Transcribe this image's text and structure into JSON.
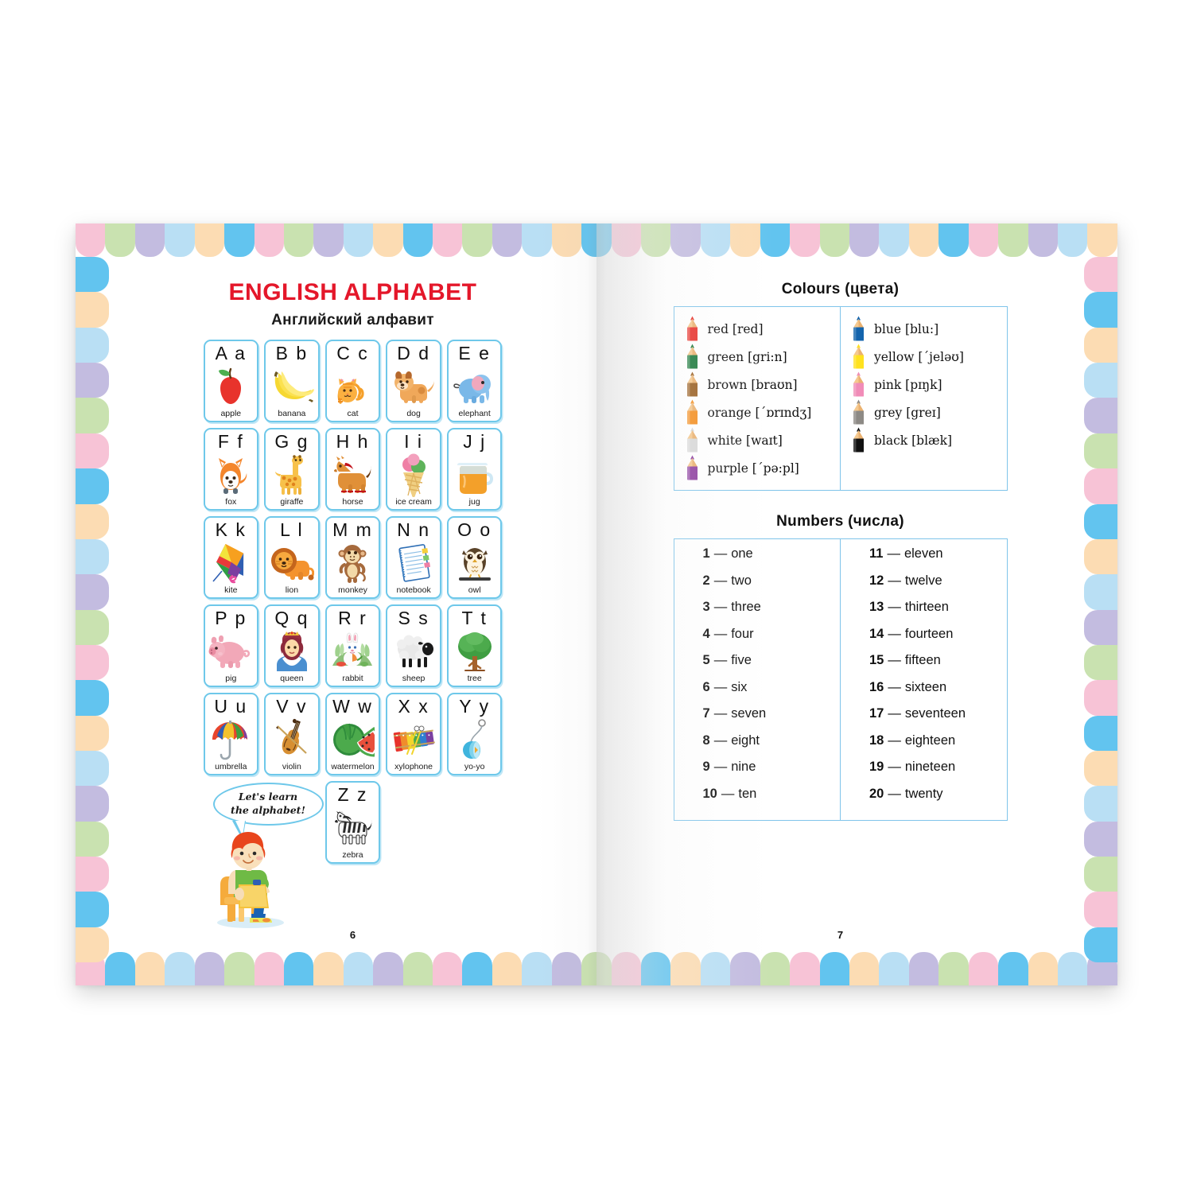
{
  "book": {
    "left_page_number": "6",
    "right_page_number": "7",
    "border_colors": [
      "#f7c3d6",
      "#c9e2b0",
      "#c3bce0",
      "#b9dff4",
      "#fcdcb3",
      "#62c4ef"
    ],
    "accent_blue": "#6ec8ea",
    "title_red": "#e4172a"
  },
  "left_page": {
    "title": "ENGLISH ALPHABET",
    "subtitle": "Английский  алфавит",
    "mascot": {
      "bubble_line1": "Let's learn",
      "bubble_line2": "the alphabet!"
    },
    "letters": [
      {
        "letter": "A a",
        "word": "apple",
        "icon": "apple-icon"
      },
      {
        "letter": "B b",
        "word": "banana",
        "icon": "banana-icon"
      },
      {
        "letter": "C c",
        "word": "cat",
        "icon": "cat-icon"
      },
      {
        "letter": "D d",
        "word": "dog",
        "icon": "dog-icon"
      },
      {
        "letter": "E e",
        "word": "elephant",
        "icon": "elephant-icon"
      },
      {
        "letter": "F f",
        "word": "fox",
        "icon": "fox-icon"
      },
      {
        "letter": "G g",
        "word": "giraffe",
        "icon": "giraffe-icon"
      },
      {
        "letter": "H h",
        "word": "horse",
        "icon": "horse-icon"
      },
      {
        "letter": "I i",
        "word": "ice cream",
        "icon": "ice-cream-icon"
      },
      {
        "letter": "J j",
        "word": "jug",
        "icon": "jug-icon"
      },
      {
        "letter": "K k",
        "word": "kite",
        "icon": "kite-icon"
      },
      {
        "letter": "L l",
        "word": "lion",
        "icon": "lion-icon"
      },
      {
        "letter": "M m",
        "word": "monkey",
        "icon": "monkey-icon"
      },
      {
        "letter": "N n",
        "word": "notebook",
        "icon": "notebook-icon"
      },
      {
        "letter": "O o",
        "word": "owl",
        "icon": "owl-icon"
      },
      {
        "letter": "P p",
        "word": "pig",
        "icon": "pig-icon"
      },
      {
        "letter": "Q q",
        "word": "queen",
        "icon": "queen-icon"
      },
      {
        "letter": "R r",
        "word": "rabbit",
        "icon": "rabbit-icon"
      },
      {
        "letter": "S s",
        "word": "sheep",
        "icon": "sheep-icon"
      },
      {
        "letter": "T t",
        "word": "tree",
        "icon": "tree-icon"
      },
      {
        "letter": "U u",
        "word": "umbrella",
        "icon": "umbrella-icon"
      },
      {
        "letter": "V v",
        "word": "violin",
        "icon": "violin-icon"
      },
      {
        "letter": "W w",
        "word": "watermelon",
        "icon": "watermelon-icon"
      },
      {
        "letter": "X x",
        "word": "xylophone",
        "icon": "xylophone-icon"
      },
      {
        "letter": "Y y",
        "word": "yo-yo",
        "icon": "yoyo-icon"
      },
      {
        "letter": "Z z",
        "word": "zebra",
        "icon": "zebra-icon"
      }
    ]
  },
  "right_page": {
    "colours": {
      "title": "Colours  (цвета)",
      "left_column": [
        {
          "label": "red [red]",
          "swatch": "#e8322c"
        },
        {
          "label": "green [gri:n]",
          "swatch": "#1d7a3d"
        },
        {
          "label": "brown [braʊn]",
          "swatch": "#9a6124"
        },
        {
          "label": "orange [´ɒrɪndʒ]",
          "swatch": "#f59022"
        },
        {
          "label": "white [waɪt]",
          "swatch": "#d9d9d9"
        },
        {
          "label": "purple [´pə:pl]",
          "swatch": "#8e3fa0"
        }
      ],
      "right_column": [
        {
          "label": "blue [blu:]",
          "swatch": "#1464ad"
        },
        {
          "label": "yellow [´jeləʊ]",
          "swatch": "#ffe21f"
        },
        {
          "label": "pink [pɪŋk]",
          "swatch": "#f08cb8"
        },
        {
          "label": "grey [greɪ]",
          "swatch": "#8d8a85"
        },
        {
          "label": "black [blæk]",
          "swatch": "#111111"
        }
      ]
    },
    "numbers": {
      "title": "Numbers  (числа)",
      "dash": "—",
      "left_column": [
        {
          "n": "1",
          "w": "one"
        },
        {
          "n": "2",
          "w": "two"
        },
        {
          "n": "3",
          "w": "three"
        },
        {
          "n": "4",
          "w": "four"
        },
        {
          "n": "5",
          "w": "five"
        },
        {
          "n": "6",
          "w": "six"
        },
        {
          "n": "7",
          "w": "seven"
        },
        {
          "n": "8",
          "w": "eight"
        },
        {
          "n": "9",
          "w": "nine"
        },
        {
          "n": "10",
          "w": "ten"
        }
      ],
      "right_column": [
        {
          "n": "11",
          "w": "eleven"
        },
        {
          "n": "12",
          "w": "twelve"
        },
        {
          "n": "13",
          "w": "thirteen"
        },
        {
          "n": "14",
          "w": "fourteen"
        },
        {
          "n": "15",
          "w": "fifteen"
        },
        {
          "n": "16",
          "w": "sixteen"
        },
        {
          "n": "17",
          "w": "seventeen"
        },
        {
          "n": "18",
          "w": "eighteen"
        },
        {
          "n": "19",
          "w": "nineteen"
        },
        {
          "n": "20",
          "w": "twenty"
        }
      ]
    }
  }
}
